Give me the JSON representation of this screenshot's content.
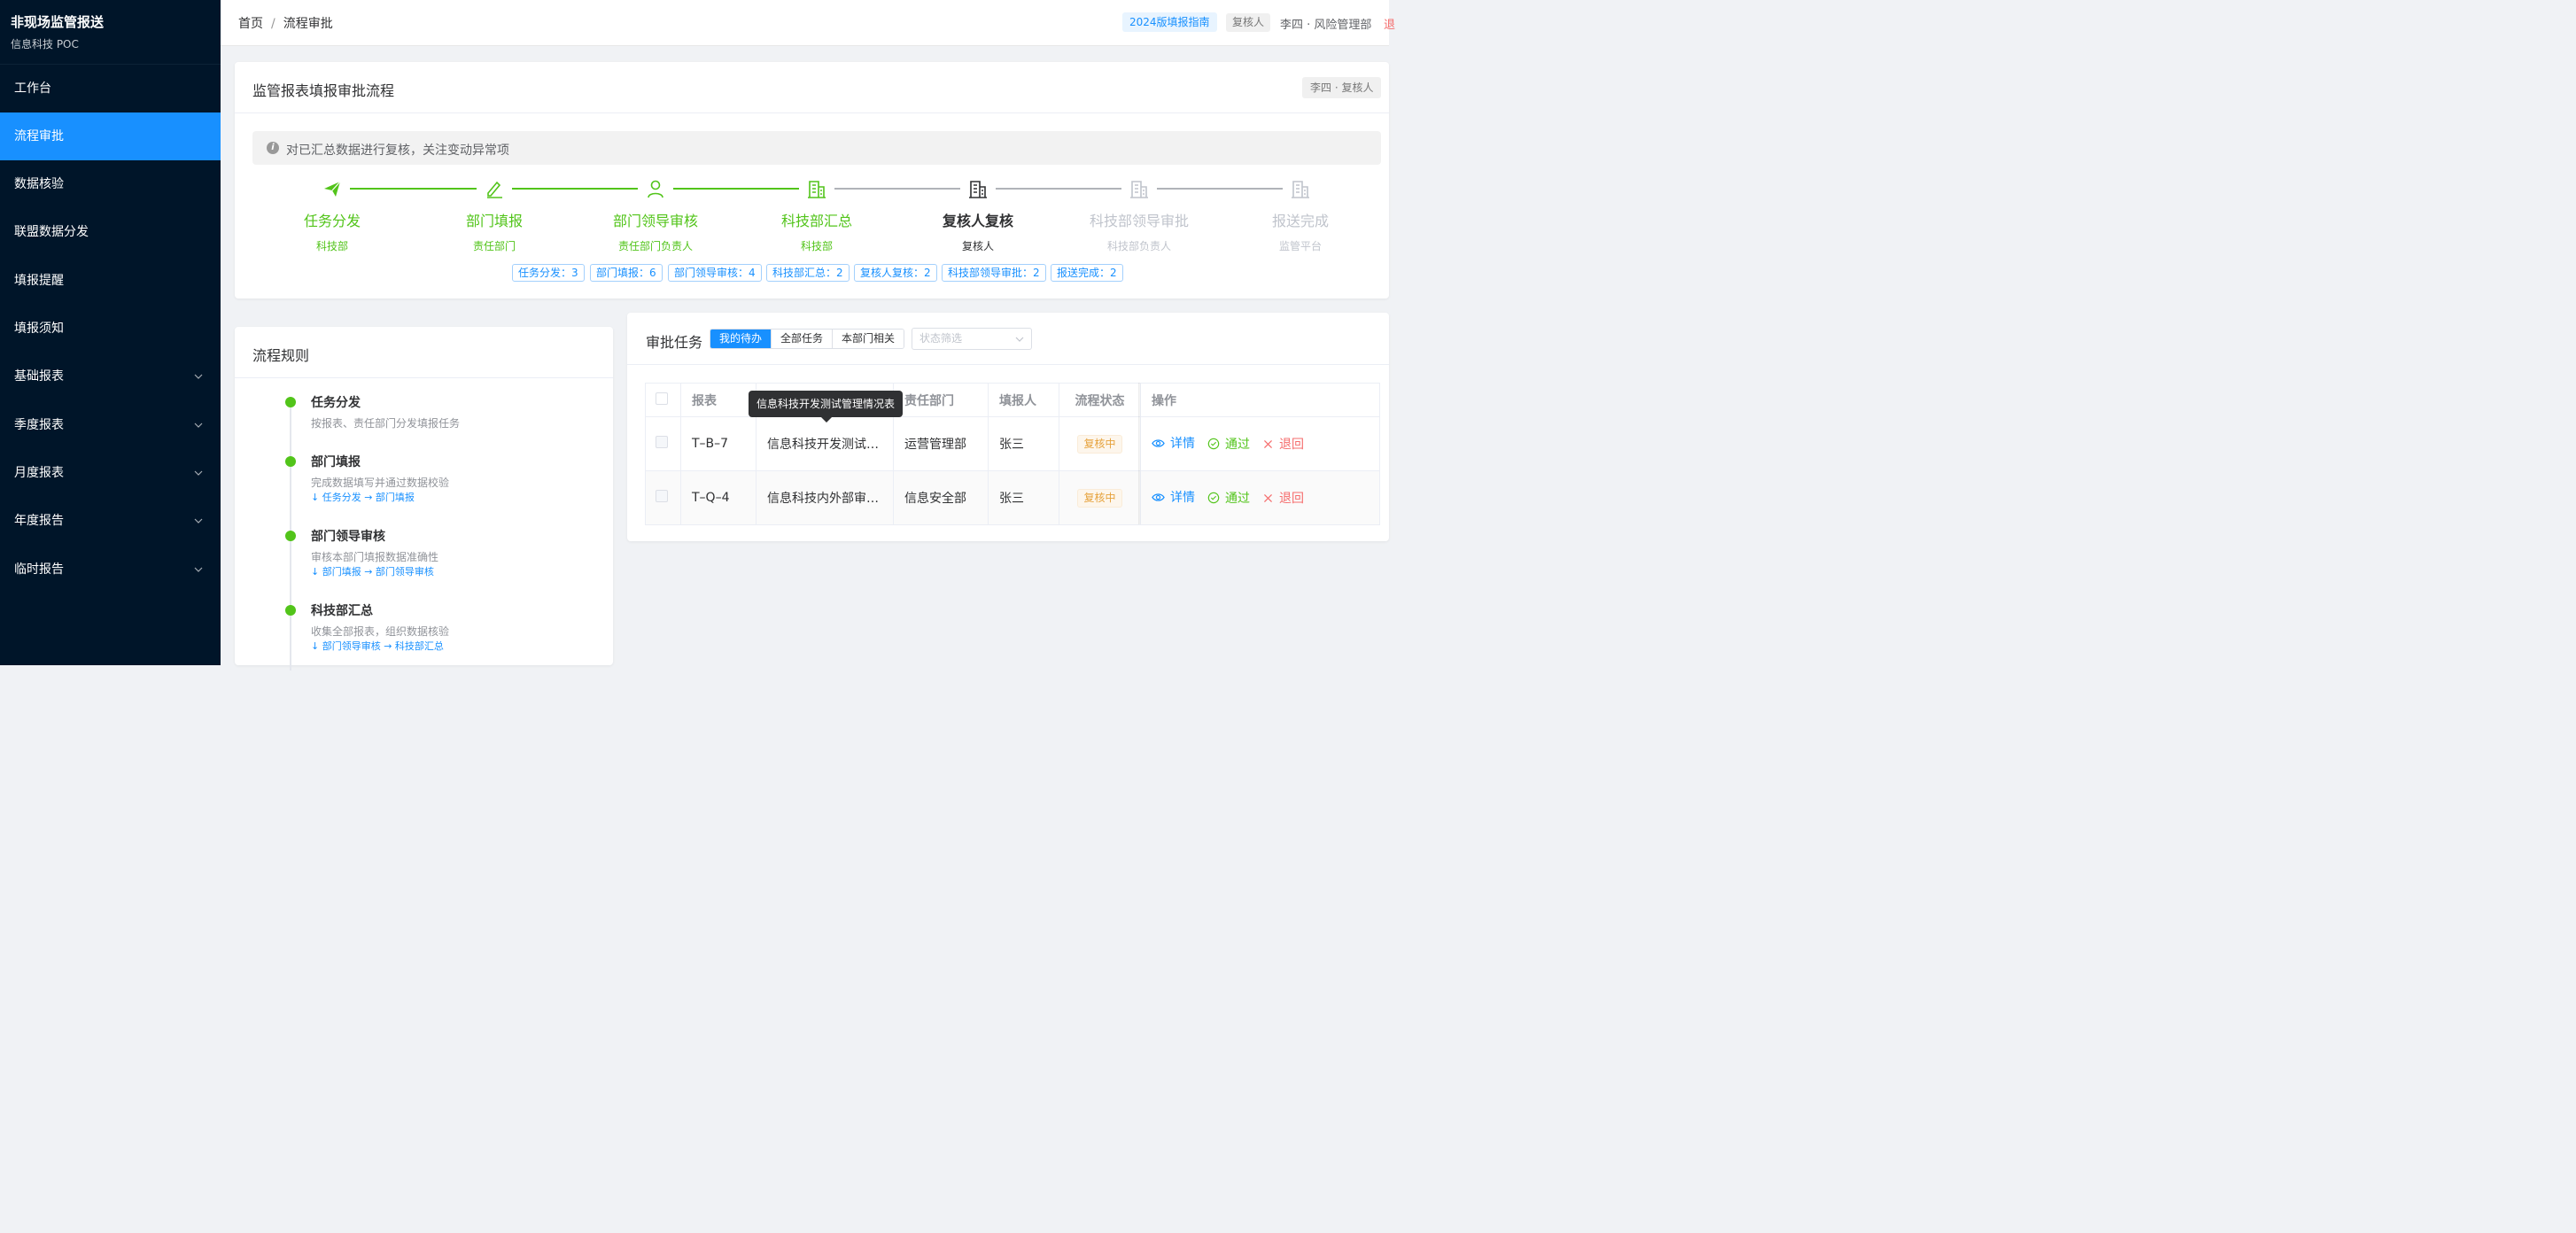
{
  "app": {
    "title": "非现场监管报送",
    "subtitle": "信息科技 POC"
  },
  "sidebar": {
    "items": [
      {
        "label": "工作台",
        "expandable": false
      },
      {
        "label": "流程审批",
        "expandable": false,
        "active": true
      },
      {
        "label": "数据核验",
        "expandable": false
      },
      {
        "label": "联盟数据分发",
        "expandable": false
      },
      {
        "label": "填报提醒",
        "expandable": false
      },
      {
        "label": "填报须知",
        "expandable": false
      },
      {
        "label": "基础报表",
        "expandable": true
      },
      {
        "label": "季度报表",
        "expandable": true
      },
      {
        "label": "月度报表",
        "expandable": true
      },
      {
        "label": "年度报告",
        "expandable": true
      },
      {
        "label": "临时报告",
        "expandable": true
      }
    ]
  },
  "header": {
    "breadcrumb": [
      "首页",
      "流程审批"
    ],
    "separator": "/",
    "guide": "2024版填报指南",
    "role_tag": "复核人",
    "user": "李四 · 风险管理部",
    "logout": "退"
  },
  "flow_card": {
    "title": "监管报表填报审批流程",
    "corner_tag": "李四 · 复核人",
    "alert": "对已汇总数据进行复核，关注变动异常项",
    "steps": [
      {
        "name": "任务分发",
        "sub": "科技部",
        "state": "done",
        "icon": "send-icon"
      },
      {
        "name": "部门填报",
        "sub": "责任部门",
        "state": "done",
        "icon": "edit-icon"
      },
      {
        "name": "部门领导审核",
        "sub": "责任部门负责人",
        "state": "done",
        "icon": "user-icon"
      },
      {
        "name": "科技部汇总",
        "sub": "科技部",
        "state": "done",
        "icon": "building-icon"
      },
      {
        "name": "复核人复核",
        "sub": "复核人",
        "state": "current",
        "icon": "building-icon"
      },
      {
        "name": "科技部领导审批",
        "sub": "科技部负责人",
        "state": "pending",
        "icon": "building-icon"
      },
      {
        "name": "报送完成",
        "sub": "监管平台",
        "state": "pending",
        "icon": "building-icon"
      }
    ],
    "counts": [
      "任务分发：3",
      "部门填报：6",
      "部门领导审核：4",
      "科技部汇总：2",
      "复核人复核：2",
      "科技部领导审批：2",
      "报送完成：2"
    ]
  },
  "rules_card": {
    "title": "流程规则",
    "items": [
      {
        "name": "任务分发",
        "desc": "按报表、责任部门分发填报任务",
        "flow": ""
      },
      {
        "name": "部门填报",
        "desc": "完成数据填写并通过数据校验",
        "flow": "↓ 任务分发 → 部门填报"
      },
      {
        "name": "部门领导审核",
        "desc": "审核本部门填报数据准确性",
        "flow": "↓ 部门填报 → 部门领导审核"
      },
      {
        "name": "科技部汇总",
        "desc": "收集全部报表，组织数据核验",
        "flow": "↓ 部门领导审核 → 科技部汇总"
      }
    ]
  },
  "tasks_card": {
    "title": "审批任务",
    "tabs": [
      "我的待办",
      "全部任务",
      "本部门相关"
    ],
    "active_tab": 0,
    "filter_placeholder": "状态筛选",
    "columns": [
      "",
      "报表",
      "",
      "责任部门",
      "填报人",
      "流程状态",
      "操作"
    ],
    "rows": [
      {
        "code": "T–B–7",
        "name": "信息科技开发测试…",
        "dept": "运营管理部",
        "filler": "张三",
        "status": "复核中"
      },
      {
        "code": "T–Q–4",
        "name": "信息科技内外部审…",
        "dept": "信息安全部",
        "filler": "张三",
        "status": "复核中"
      }
    ],
    "actions": {
      "detail": "详情",
      "approve": "通过",
      "reject": "退回"
    },
    "tooltip": "信息科技开发测试管理情况表"
  },
  "colors": {
    "sidebar": "#001529",
    "active": "#1890ff",
    "done": "#52c41a",
    "pending": "#c0c4cc",
    "current": "#303133",
    "reject": "#f56c6c",
    "warning": "#e6a23c"
  }
}
